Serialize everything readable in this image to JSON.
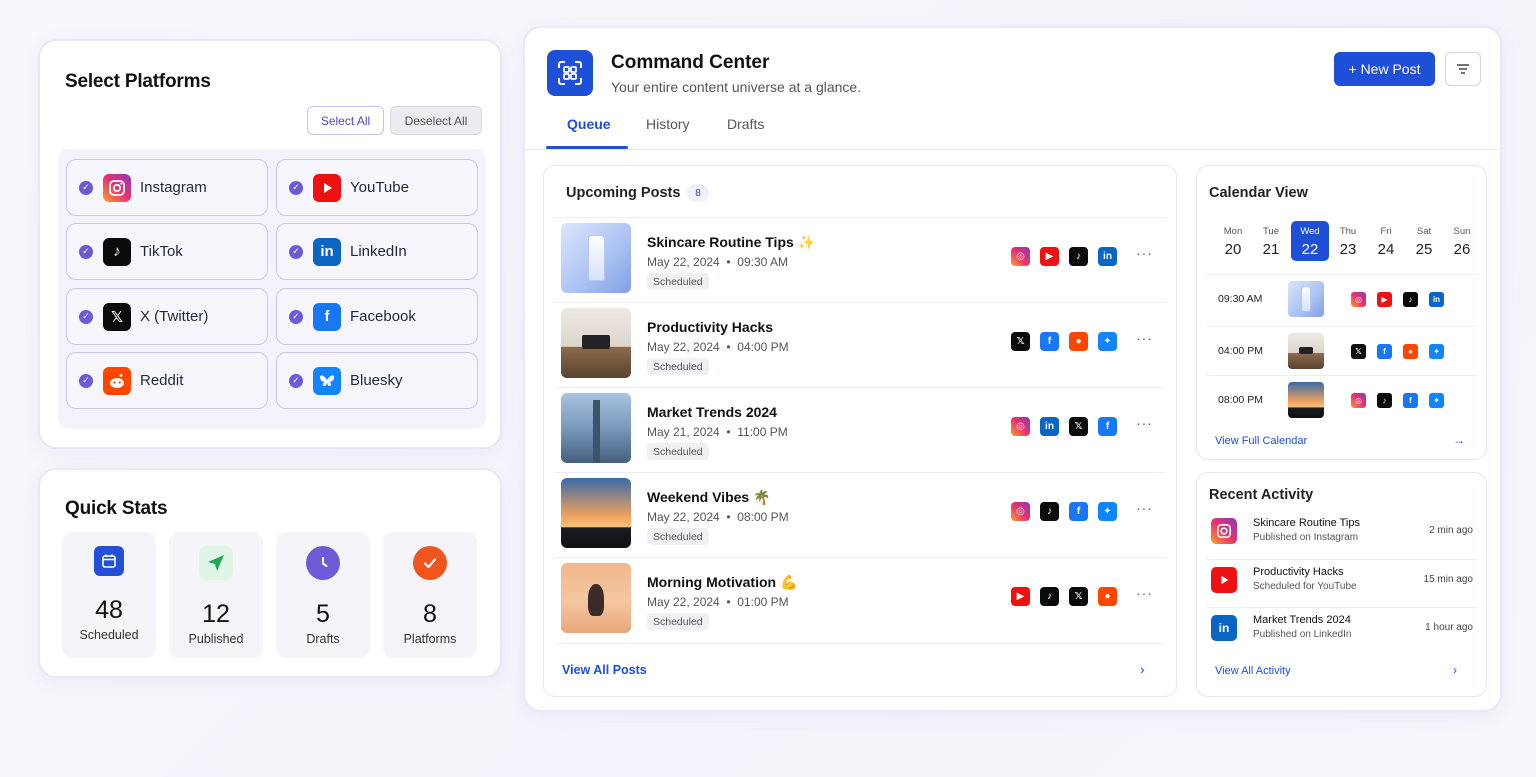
{
  "platforms_panel": {
    "title": "Select Platforms",
    "select_all": "Select All",
    "deselect_all": "Deselect All",
    "items": [
      {
        "name": "Instagram",
        "icon": "instagram-icon",
        "selected": true,
        "color": "#e6326f"
      },
      {
        "name": "YouTube",
        "icon": "youtube-icon",
        "selected": true,
        "color": "#ee1111"
      },
      {
        "name": "TikTok",
        "icon": "tiktok-icon",
        "selected": true,
        "color": "#0b0b0b"
      },
      {
        "name": "LinkedIn",
        "icon": "linkedin-icon",
        "selected": true,
        "color": "#0a66c2"
      },
      {
        "name": "X (Twitter)",
        "icon": "x-icon",
        "selected": true,
        "color": "#0b0b0b"
      },
      {
        "name": "Facebook",
        "icon": "facebook-icon",
        "selected": true,
        "color": "#1877f2"
      },
      {
        "name": "Reddit",
        "icon": "reddit-icon",
        "selected": true,
        "color": "#ff4500"
      },
      {
        "name": "Bluesky",
        "icon": "bluesky-icon",
        "selected": true,
        "color": "#1185fe"
      }
    ]
  },
  "quick_stats": {
    "title": "Quick Stats",
    "items": [
      {
        "value": "48",
        "label": "Scheduled",
        "icon": "calendar-icon"
      },
      {
        "value": "12",
        "label": "Published",
        "icon": "send-icon"
      },
      {
        "value": "5",
        "label": "Drafts",
        "icon": "clock-icon"
      },
      {
        "value": "8",
        "label": "Platforms",
        "icon": "check-circle-icon"
      }
    ]
  },
  "command_center": {
    "title": "Command Center",
    "subtitle": "Your entire content universe at a glance.",
    "new_post": "+ New Post",
    "tabs": [
      "Queue",
      "History",
      "Drafts"
    ],
    "active_tab": "Queue",
    "accent": "#1d4fd7"
  },
  "upcoming": {
    "title": "Upcoming Posts",
    "count": "8",
    "view_all": "View All Posts",
    "posts": [
      {
        "title": "Skincare Routine Tips ✨",
        "date": "May 22, 2024",
        "time": "09:30 AM",
        "status": "Scheduled",
        "thumb": "skincare",
        "platforms": [
          "instagram",
          "youtube",
          "tiktok",
          "linkedin"
        ]
      },
      {
        "title": "Productivity Hacks",
        "date": "May 22, 2024",
        "time": "04:00 PM",
        "status": "Scheduled",
        "thumb": "prod",
        "platforms": [
          "x",
          "facebook",
          "reddit",
          "bluesky"
        ]
      },
      {
        "title": "Market Trends 2024",
        "date": "May 21, 2024",
        "time": "11:00 PM",
        "status": "Scheduled",
        "thumb": "market",
        "platforms": [
          "instagram",
          "linkedin",
          "x",
          "facebook"
        ]
      },
      {
        "title": "Weekend Vibes 🌴",
        "date": "May 22, 2024",
        "time": "08:00 PM",
        "status": "Scheduled",
        "thumb": "weekend",
        "platforms": [
          "instagram",
          "tiktok",
          "facebook",
          "bluesky"
        ]
      },
      {
        "title": "Morning Motivation 💪",
        "date": "May 22, 2024",
        "time": "01:00 PM",
        "status": "Scheduled",
        "thumb": "morning",
        "platforms": [
          "youtube",
          "tiktok",
          "x",
          "reddit"
        ]
      }
    ]
  },
  "calendar": {
    "title": "Calendar View",
    "days": [
      {
        "name": "Mon",
        "num": "20",
        "active": false
      },
      {
        "name": "Tue",
        "num": "21",
        "active": false
      },
      {
        "name": "Wed",
        "num": "22",
        "active": true
      },
      {
        "name": "Thu",
        "num": "23",
        "active": false
      },
      {
        "name": "Fri",
        "num": "24",
        "active": false
      },
      {
        "name": "Sat",
        "num": "25",
        "active": false
      },
      {
        "name": "Sun",
        "num": "26",
        "active": false
      }
    ],
    "slots": [
      {
        "time": "09:30 AM",
        "thumb": "skincare",
        "platforms": [
          "instagram",
          "youtube",
          "tiktok",
          "linkedin"
        ]
      },
      {
        "time": "04:00 PM",
        "thumb": "prod",
        "platforms": [
          "x",
          "facebook",
          "reddit",
          "bluesky"
        ]
      },
      {
        "time": "08:00 PM",
        "thumb": "weekend",
        "platforms": [
          "instagram",
          "tiktok",
          "facebook",
          "bluesky"
        ]
      }
    ],
    "view_full": "View Full Calendar"
  },
  "activity": {
    "title": "Recent Activity",
    "items": [
      {
        "title": "Skincare Routine Tips",
        "sub": "Published on Instagram",
        "time": "2 min ago",
        "platform": "instagram"
      },
      {
        "title": "Productivity Hacks",
        "sub": "Scheduled for YouTube",
        "time": "15 min ago",
        "platform": "youtube"
      },
      {
        "title": "Market Trends 2024",
        "sub": "Published on LinkedIn",
        "time": "1 hour ago",
        "platform": "linkedin"
      }
    ],
    "view_all": "View All Activity"
  },
  "separator": "•",
  "more_label": "···",
  "arrow_label": "›",
  "arrow_right": "→"
}
